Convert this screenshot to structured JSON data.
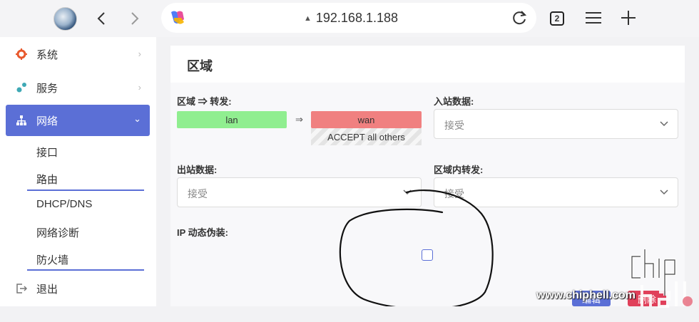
{
  "browser": {
    "url": "192.168.1.188",
    "tab_count": "2"
  },
  "sidebar": {
    "items": [
      {
        "label": "系统",
        "icon": "gear-icon"
      },
      {
        "label": "服务",
        "icon": "services-icon"
      },
      {
        "label": "网络",
        "icon": "network-icon"
      }
    ],
    "sub_items": [
      "接口",
      "路由",
      "DHCP/DNS",
      "网络诊断",
      "防火墙"
    ],
    "logout": {
      "label": "退出",
      "icon": "logout-icon"
    }
  },
  "main": {
    "title": "区域",
    "zone_forward_label": "区域 ⇒ 转发:",
    "lan": "lan",
    "arrow": "⇒",
    "wan": "wan",
    "wan_sub": "ACCEPT all others",
    "input_label": "入站数据:",
    "input_value": "接受",
    "output_label": "出站数据:",
    "output_value": "接受",
    "forward_label": "区域内转发:",
    "forward_value": "接受",
    "masq_label": "IP 动态伪装:"
  },
  "actions": {
    "edit": "编辑",
    "delete": "删除"
  },
  "watermark": {
    "url": "www.chiphell.com",
    "logo_text": "chiphell"
  },
  "colors": {
    "accent": "#5b6fd6",
    "lan": "#90ee90",
    "wan": "#f08080",
    "gear": "#e8582c"
  }
}
